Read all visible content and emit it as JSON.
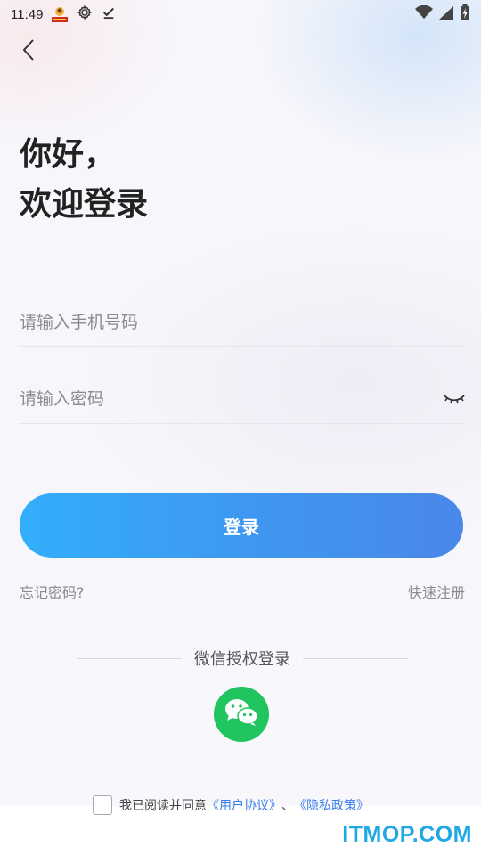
{
  "status_bar": {
    "time": "11:49",
    "icons": [
      "app-badge-icon",
      "settings-gear-icon",
      "download-done-icon",
      "wifi-icon",
      "signal-icon",
      "battery-charging-icon"
    ]
  },
  "header": {
    "back_icon": "chevron-left-icon"
  },
  "greeting": {
    "line1": "你好，",
    "line2": "欢迎登录"
  },
  "form": {
    "phone": {
      "placeholder": "请输入手机号码",
      "value": ""
    },
    "password": {
      "placeholder": "请输入密码",
      "value": "",
      "toggle_icon": "eye-closed-icon"
    }
  },
  "actions": {
    "login_label": "登录",
    "forgot_label": "忘记密码?",
    "register_label": "快速注册"
  },
  "social": {
    "title": "微信授权登录",
    "icon": "wechat-icon",
    "color": "#21c55f"
  },
  "agreement": {
    "prefix": "我已阅读并同意",
    "user_agreement": "《用户协议》",
    "separator": "、",
    "privacy_policy": "《隐私政策》",
    "checked": false
  },
  "theme": {
    "accent_start": "#33aefb",
    "accent_end": "#4987e8",
    "link_color": "#3a7ee6"
  },
  "watermark": "ITMOP.COM"
}
